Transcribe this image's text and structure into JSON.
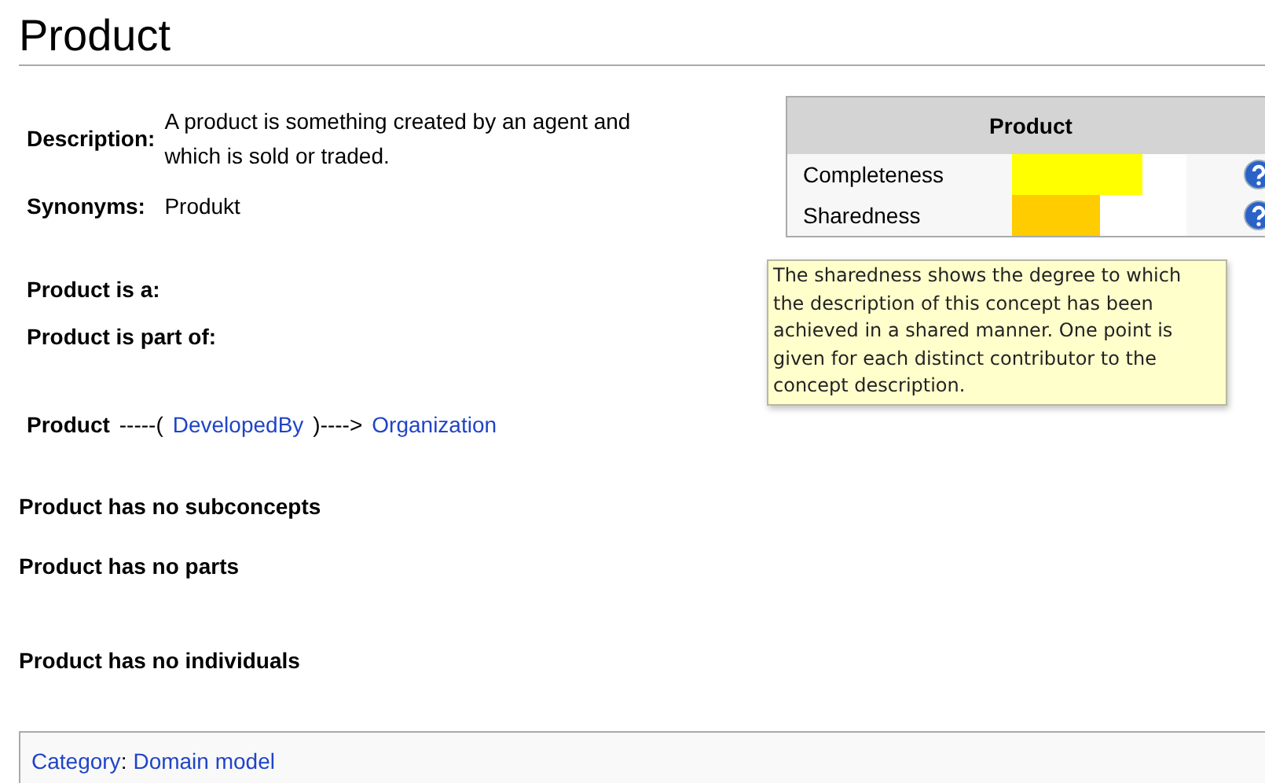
{
  "title": "Product",
  "properties": [
    {
      "label": "Description:",
      "value": "A product is something created by an agent and which is sold or traded."
    },
    {
      "label": "Synonyms:",
      "value": "Produkt"
    }
  ],
  "relations_headings": [
    "Product is a:",
    "Product is part of:"
  ],
  "relation": {
    "subject": "Product",
    "prefix": "-----(",
    "predicate": "DevelopedBy",
    "suffix": ")---->",
    "object": "Organization"
  },
  "quality_panel": {
    "title": "Product",
    "metrics": [
      {
        "name": "Completeness",
        "level": 0.75,
        "color": "#ffff00"
      },
      {
        "name": "Sharedness",
        "level": 0.5,
        "color": "#ffcc00"
      }
    ]
  },
  "tooltip": "The sharedness shows the degree to which the description of this concept has been achieved in a shared manner. One point is given for each distinct contributor to the concept description.",
  "statements": [
    "Product has no subconcepts",
    "Product has no parts",
    "Product has no individuals"
  ],
  "category": {
    "label": "Category",
    "separator": ":",
    "value": "Domain model"
  }
}
